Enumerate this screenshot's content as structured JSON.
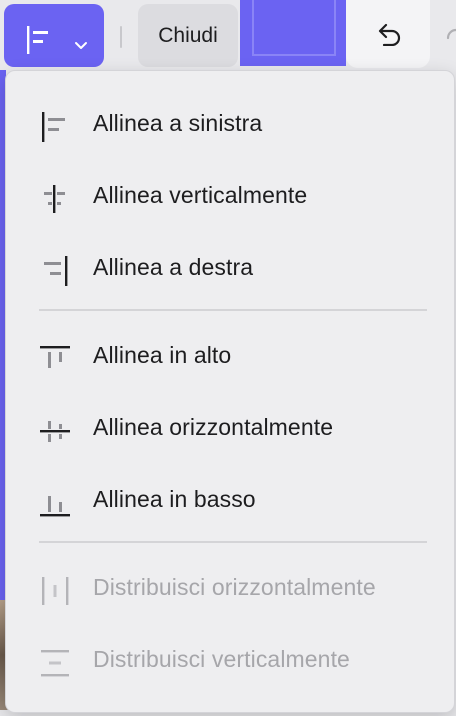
{
  "toolbar": {
    "align_icon": "align-left-icon",
    "dropdown_icon": "chevron-down-icon",
    "close_label": "Chiudi",
    "undo_icon": "undo-icon",
    "accent_color": "#6b63f2"
  },
  "menu": {
    "groups": [
      [
        {
          "label": "Allinea a sinistra",
          "icon": "align-left-icon",
          "enabled": true
        },
        {
          "label": "Allinea verticalmente",
          "icon": "align-center-vertical-icon",
          "enabled": true
        },
        {
          "label": "Allinea a destra",
          "icon": "align-right-icon",
          "enabled": true
        }
      ],
      [
        {
          "label": "Allinea in alto",
          "icon": "align-top-icon",
          "enabled": true
        },
        {
          "label": "Allinea orizzontalmente",
          "icon": "align-middle-horizontal-icon",
          "enabled": true
        },
        {
          "label": "Allinea in basso",
          "icon": "align-bottom-icon",
          "enabled": true
        }
      ],
      [
        {
          "label": "Distribuisci orizzontalmente",
          "icon": "distribute-horizontal-icon",
          "enabled": false
        },
        {
          "label": "Distribuisci verticalmente",
          "icon": "distribute-vertical-icon",
          "enabled": false
        }
      ]
    ]
  }
}
